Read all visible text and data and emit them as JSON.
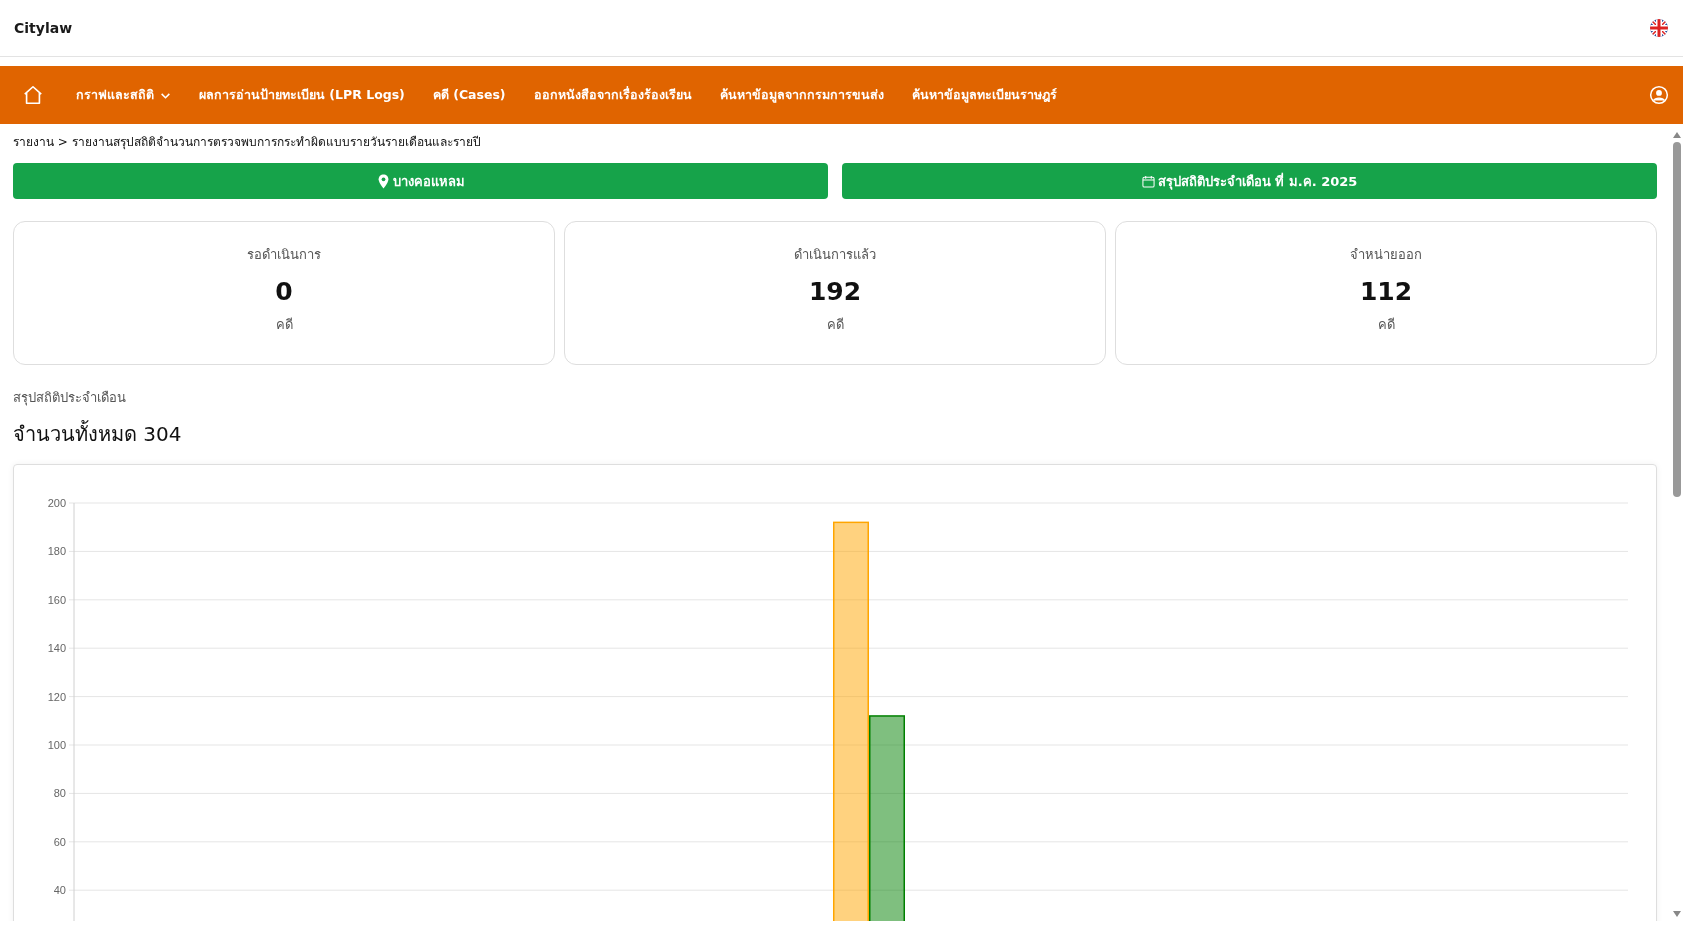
{
  "header": {
    "brand": "Citylaw"
  },
  "nav": {
    "items": [
      {
        "label": "กราฟและสถิติ",
        "kind": "dropdown"
      },
      {
        "label": "ผลการอ่านป้ายทะเบียน (LPR Logs)",
        "kind": "link"
      },
      {
        "label": "คดี (Cases)",
        "kind": "link"
      },
      {
        "label": "ออกหนังสือจากเรื่องร้องเรียน",
        "kind": "link"
      },
      {
        "label": "ค้นหาข้อมูลจากกรมการขนส่ง",
        "kind": "link"
      },
      {
        "label": "ค้นหาข้อมูลทะเบียนราษฎร์",
        "kind": "link"
      }
    ]
  },
  "breadcrumb": "รายงาน > รายงานสรุปสถิติจำนวนการตรวจพบการกระทำผิดแบบรายวันรายเดือนและรายปี",
  "filters": [
    {
      "label": "บางคอแหลม",
      "kind": "location"
    },
    {
      "label": "สรุปสถิติประจำเดือน ที่ ม.ค. 2025",
      "kind": "date"
    }
  ],
  "stat_cards": [
    {
      "label": "รอดำเนินการ",
      "value": "0",
      "unit": "คดี"
    },
    {
      "label": "ดำเนินการแล้ว",
      "value": "192",
      "unit": "คดี"
    },
    {
      "label": "จำหน่ายออก",
      "value": "112",
      "unit": "คดี"
    }
  ],
  "summary": {
    "subtitle": "สรุปสถิติประจำเดือน",
    "title": "จำนวนทั้งหมด 304",
    "chart_data": {
      "type": "bar",
      "grid": true,
      "ylim": [
        0,
        200
      ],
      "yticks": [
        40,
        60,
        80,
        100,
        120,
        140,
        160,
        180,
        200
      ],
      "series": [
        {
          "values": [
            0
          ]
        },
        {
          "color": "#ffa500",
          "values": [
            192
          ]
        },
        {
          "color": "#008000",
          "values": [
            112
          ]
        }
      ]
    }
  }
}
